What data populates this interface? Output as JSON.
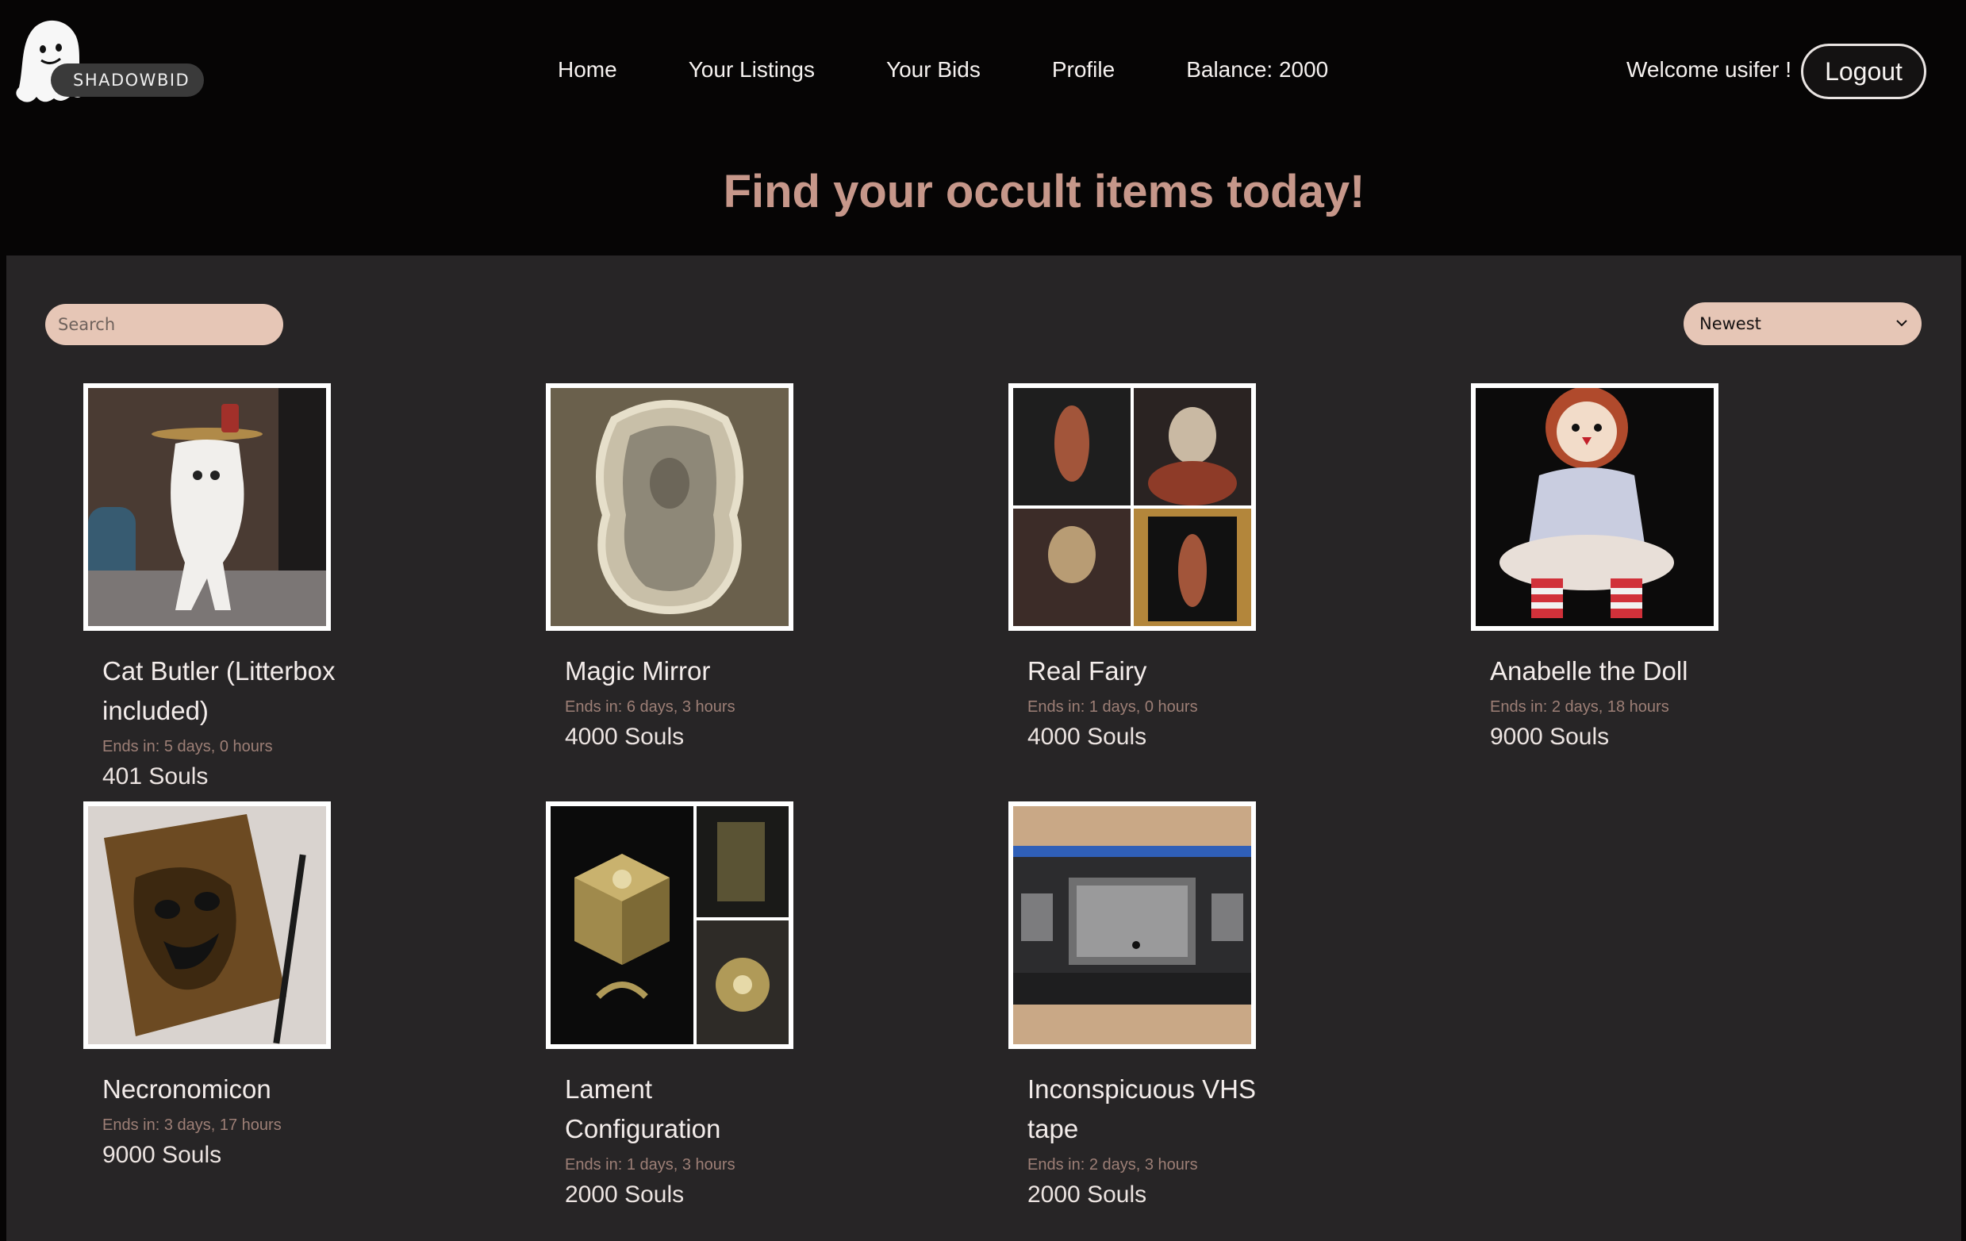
{
  "brand": {
    "name": "SHADOWBID"
  },
  "nav": {
    "items": [
      {
        "label": "Home"
      },
      {
        "label": "Your Listings"
      },
      {
        "label": "Your Bids"
      },
      {
        "label": "Profile"
      },
      {
        "label": "Balance: 2000"
      }
    ]
  },
  "user": {
    "welcome": "Welcome usifer !",
    "logout_label": "Logout"
  },
  "hero": {
    "title": "Find your occult items today!"
  },
  "controls": {
    "search_placeholder": "Search",
    "sort_selected": "Newest"
  },
  "listings": [
    {
      "title": "Cat Butler (Litterbox included)",
      "ends": "Ends in: 5 days, 0 hours",
      "price": "401 Souls",
      "image": "cat-butler-image"
    },
    {
      "title": "Magic Mirror",
      "ends": "Ends in: 6 days, 3 hours",
      "price": "4000 Souls",
      "image": "magic-mirror-image"
    },
    {
      "title": "Real Fairy",
      "ends": "Ends in: 1 days, 0 hours",
      "price": "4000 Souls",
      "image": "real-fairy-image"
    },
    {
      "title": "Anabelle the Doll",
      "ends": "Ends in: 2 days, 18 hours",
      "price": "9000 Souls",
      "image": "doll-image"
    },
    {
      "title": "Necronomicon",
      "ends": "Ends in: 3 days, 17 hours",
      "price": "9000 Souls",
      "image": "necronomicon-image"
    },
    {
      "title": "Lament Configuration",
      "ends": "Ends in: 1 days, 3 hours",
      "price": "2000 Souls",
      "image": "puzzle-box-image"
    },
    {
      "title": "Inconspicuous VHS tape",
      "ends": "Ends in: 2 days, 3 hours",
      "price": "2000 Souls",
      "image": "vhs-tape-image"
    }
  ],
  "colors": {
    "background": "#060505",
    "panel": "#272526",
    "accent": "#c6978a",
    "control_fill": "#e6c6b6"
  }
}
